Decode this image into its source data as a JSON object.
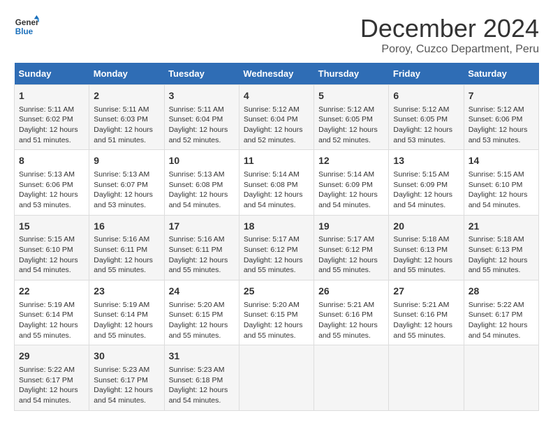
{
  "logo": {
    "line1": "General",
    "line2": "Blue"
  },
  "title": "December 2024",
  "subtitle": "Poroy, Cuzco Department, Peru",
  "days_header": [
    "Sunday",
    "Monday",
    "Tuesday",
    "Wednesday",
    "Thursday",
    "Friday",
    "Saturday"
  ],
  "weeks": [
    [
      {
        "day": "1",
        "sunrise": "Sunrise: 5:11 AM",
        "sunset": "Sunset: 6:02 PM",
        "daylight": "Daylight: 12 hours and 51 minutes."
      },
      {
        "day": "2",
        "sunrise": "Sunrise: 5:11 AM",
        "sunset": "Sunset: 6:03 PM",
        "daylight": "Daylight: 12 hours and 51 minutes."
      },
      {
        "day": "3",
        "sunrise": "Sunrise: 5:11 AM",
        "sunset": "Sunset: 6:04 PM",
        "daylight": "Daylight: 12 hours and 52 minutes."
      },
      {
        "day": "4",
        "sunrise": "Sunrise: 5:12 AM",
        "sunset": "Sunset: 6:04 PM",
        "daylight": "Daylight: 12 hours and 52 minutes."
      },
      {
        "day": "5",
        "sunrise": "Sunrise: 5:12 AM",
        "sunset": "Sunset: 6:05 PM",
        "daylight": "Daylight: 12 hours and 52 minutes."
      },
      {
        "day": "6",
        "sunrise": "Sunrise: 5:12 AM",
        "sunset": "Sunset: 6:05 PM",
        "daylight": "Daylight: 12 hours and 53 minutes."
      },
      {
        "day": "7",
        "sunrise": "Sunrise: 5:12 AM",
        "sunset": "Sunset: 6:06 PM",
        "daylight": "Daylight: 12 hours and 53 minutes."
      }
    ],
    [
      {
        "day": "8",
        "sunrise": "Sunrise: 5:13 AM",
        "sunset": "Sunset: 6:06 PM",
        "daylight": "Daylight: 12 hours and 53 minutes."
      },
      {
        "day": "9",
        "sunrise": "Sunrise: 5:13 AM",
        "sunset": "Sunset: 6:07 PM",
        "daylight": "Daylight: 12 hours and 53 minutes."
      },
      {
        "day": "10",
        "sunrise": "Sunrise: 5:13 AM",
        "sunset": "Sunset: 6:08 PM",
        "daylight": "Daylight: 12 hours and 54 minutes."
      },
      {
        "day": "11",
        "sunrise": "Sunrise: 5:14 AM",
        "sunset": "Sunset: 6:08 PM",
        "daylight": "Daylight: 12 hours and 54 minutes."
      },
      {
        "day": "12",
        "sunrise": "Sunrise: 5:14 AM",
        "sunset": "Sunset: 6:09 PM",
        "daylight": "Daylight: 12 hours and 54 minutes."
      },
      {
        "day": "13",
        "sunrise": "Sunrise: 5:15 AM",
        "sunset": "Sunset: 6:09 PM",
        "daylight": "Daylight: 12 hours and 54 minutes."
      },
      {
        "day": "14",
        "sunrise": "Sunrise: 5:15 AM",
        "sunset": "Sunset: 6:10 PM",
        "daylight": "Daylight: 12 hours and 54 minutes."
      }
    ],
    [
      {
        "day": "15",
        "sunrise": "Sunrise: 5:15 AM",
        "sunset": "Sunset: 6:10 PM",
        "daylight": "Daylight: 12 hours and 54 minutes."
      },
      {
        "day": "16",
        "sunrise": "Sunrise: 5:16 AM",
        "sunset": "Sunset: 6:11 PM",
        "daylight": "Daylight: 12 hours and 55 minutes."
      },
      {
        "day": "17",
        "sunrise": "Sunrise: 5:16 AM",
        "sunset": "Sunset: 6:11 PM",
        "daylight": "Daylight: 12 hours and 55 minutes."
      },
      {
        "day": "18",
        "sunrise": "Sunrise: 5:17 AM",
        "sunset": "Sunset: 6:12 PM",
        "daylight": "Daylight: 12 hours and 55 minutes."
      },
      {
        "day": "19",
        "sunrise": "Sunrise: 5:17 AM",
        "sunset": "Sunset: 6:12 PM",
        "daylight": "Daylight: 12 hours and 55 minutes."
      },
      {
        "day": "20",
        "sunrise": "Sunrise: 5:18 AM",
        "sunset": "Sunset: 6:13 PM",
        "daylight": "Daylight: 12 hours and 55 minutes."
      },
      {
        "day": "21",
        "sunrise": "Sunrise: 5:18 AM",
        "sunset": "Sunset: 6:13 PM",
        "daylight": "Daylight: 12 hours and 55 minutes."
      }
    ],
    [
      {
        "day": "22",
        "sunrise": "Sunrise: 5:19 AM",
        "sunset": "Sunset: 6:14 PM",
        "daylight": "Daylight: 12 hours and 55 minutes."
      },
      {
        "day": "23",
        "sunrise": "Sunrise: 5:19 AM",
        "sunset": "Sunset: 6:14 PM",
        "daylight": "Daylight: 12 hours and 55 minutes."
      },
      {
        "day": "24",
        "sunrise": "Sunrise: 5:20 AM",
        "sunset": "Sunset: 6:15 PM",
        "daylight": "Daylight: 12 hours and 55 minutes."
      },
      {
        "day": "25",
        "sunrise": "Sunrise: 5:20 AM",
        "sunset": "Sunset: 6:15 PM",
        "daylight": "Daylight: 12 hours and 55 minutes."
      },
      {
        "day": "26",
        "sunrise": "Sunrise: 5:21 AM",
        "sunset": "Sunset: 6:16 PM",
        "daylight": "Daylight: 12 hours and 55 minutes."
      },
      {
        "day": "27",
        "sunrise": "Sunrise: 5:21 AM",
        "sunset": "Sunset: 6:16 PM",
        "daylight": "Daylight: 12 hours and 55 minutes."
      },
      {
        "day": "28",
        "sunrise": "Sunrise: 5:22 AM",
        "sunset": "Sunset: 6:17 PM",
        "daylight": "Daylight: 12 hours and 54 minutes."
      }
    ],
    [
      {
        "day": "29",
        "sunrise": "Sunrise: 5:22 AM",
        "sunset": "Sunset: 6:17 PM",
        "daylight": "Daylight: 12 hours and 54 minutes."
      },
      {
        "day": "30",
        "sunrise": "Sunrise: 5:23 AM",
        "sunset": "Sunset: 6:17 PM",
        "daylight": "Daylight: 12 hours and 54 minutes."
      },
      {
        "day": "31",
        "sunrise": "Sunrise: 5:23 AM",
        "sunset": "Sunset: 6:18 PM",
        "daylight": "Daylight: 12 hours and 54 minutes."
      },
      null,
      null,
      null,
      null
    ]
  ]
}
